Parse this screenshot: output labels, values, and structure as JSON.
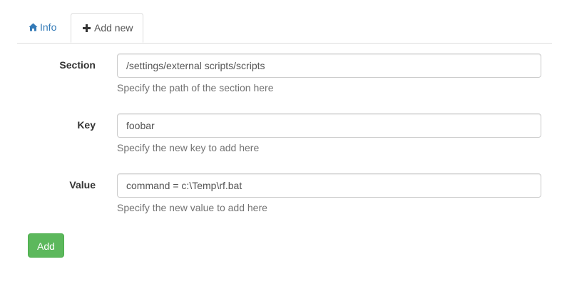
{
  "tabs": {
    "info": {
      "label": "Info",
      "icon": "home-icon",
      "color": "#337ab7"
    },
    "add_new": {
      "label": "Add new",
      "icon": "plus-icon",
      "active": true
    }
  },
  "form": {
    "section": {
      "label": "Section",
      "value": "/settings/external scripts/scripts",
      "help": "Specify the path of the section here"
    },
    "key": {
      "label": "Key",
      "value": "foobar",
      "help": "Specify the new key to add here"
    },
    "value": {
      "label": "Value",
      "value": "command = c:\\Temp\\rf.bat",
      "help": "Specify the new value to add here"
    }
  },
  "actions": {
    "add_label": "Add",
    "add_color": "#5cb85c"
  }
}
